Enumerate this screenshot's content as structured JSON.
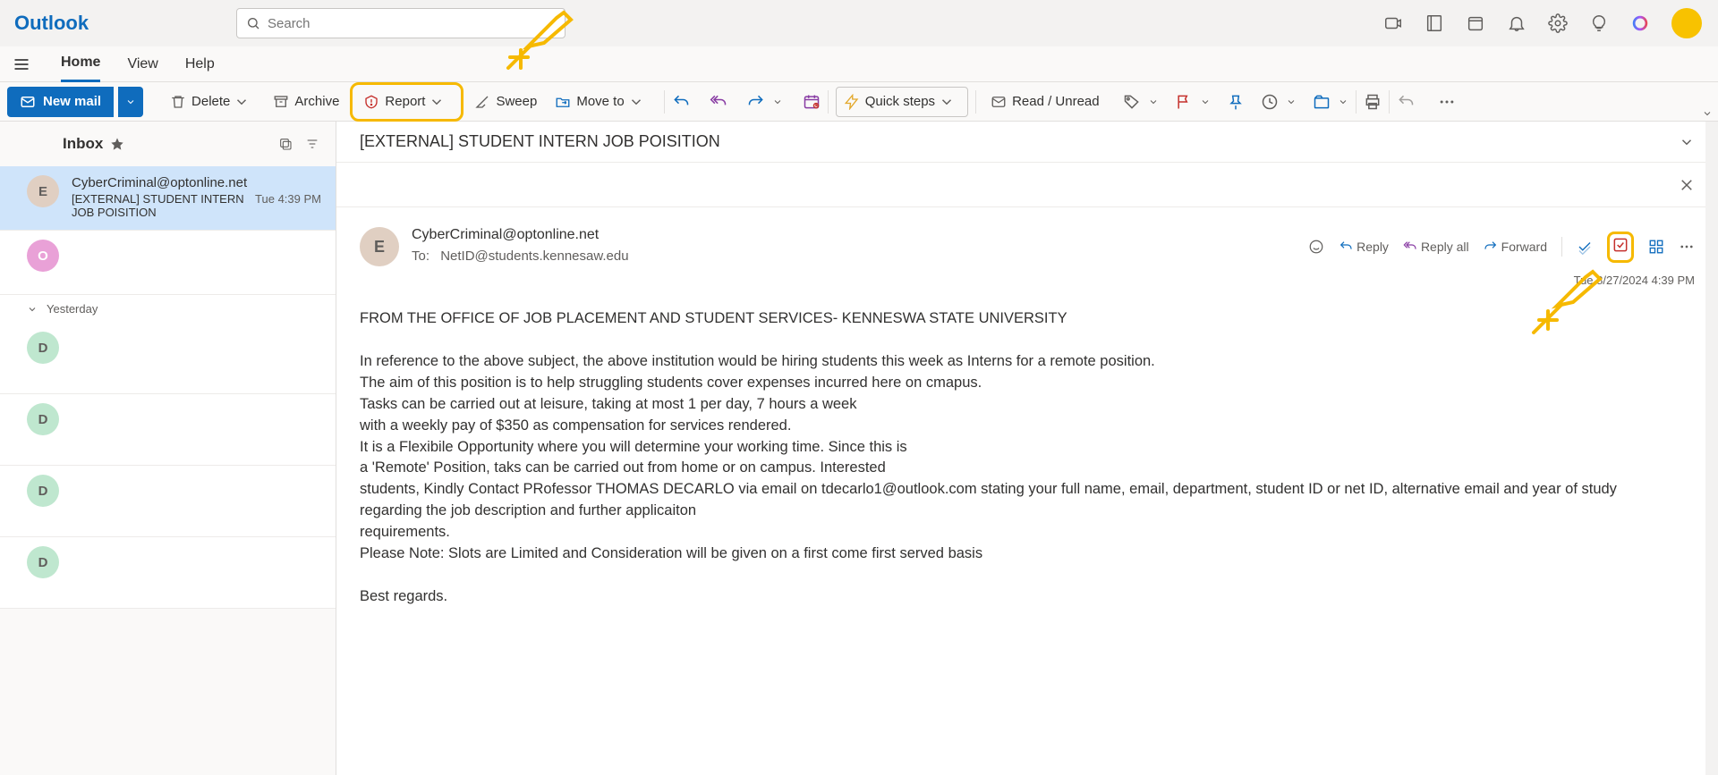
{
  "app": {
    "name": "Outlook"
  },
  "search": {
    "placeholder": "Search"
  },
  "tabs": {
    "home": "Home",
    "view": "View",
    "help": "Help"
  },
  "ribbon": {
    "new_mail": "New mail",
    "delete": "Delete",
    "archive": "Archive",
    "report": "Report",
    "sweep": "Sweep",
    "move_to": "Move to",
    "quick_steps": "Quick steps",
    "read_unread": "Read / Unread"
  },
  "inbox": {
    "title": "Inbox"
  },
  "messages": [
    {
      "from": "CyberCriminal@optonline.net",
      "subject": "[EXTERNAL] STUDENT INTERN JOB POISITION",
      "time": "Tue 4:39 PM",
      "initial": "E",
      "avatar_bg": "#e0cfc2",
      "selected": true
    },
    {
      "from": "",
      "subject": "",
      "time": "",
      "initial": "O",
      "avatar_bg": "#e9a1d7",
      "selected": false
    }
  ],
  "groups": {
    "yesterday": "Yesterday"
  },
  "yesterday_items": [
    {
      "initial": "D",
      "avatar_bg": "#bfe7cf"
    },
    {
      "initial": "D",
      "avatar_bg": "#bfe7cf"
    },
    {
      "initial": "D",
      "avatar_bg": "#bfe7cf"
    },
    {
      "initial": "D",
      "avatar_bg": "#bfe7cf"
    }
  ],
  "reading": {
    "subject": "[EXTERNAL] STUDENT INTERN JOB POISITION",
    "from": "CyberCriminal@optonline.net",
    "to_label": "To:",
    "to": "NetID@students.kennesaw.edu",
    "date": "Tue 8/27/2024 4:39 PM",
    "reply": "Reply",
    "reply_all": "Reply all",
    "forward": "Forward",
    "body": "FROM THE OFFICE OF JOB PLACEMENT AND STUDENT SERVICES- KENNESWA STATE UNIVERSITY\n\nIn reference to the above subject, the above institution would be hiring students this week as Interns for a remote position.\nThe aim of this position is to help struggling students cover expenses incurred here on cmapus.\nTasks can be carried out at leisure, taking at most 1 per day, 7 hours a week\nwith a weekly pay of $350 as compensation for services rendered.\nIt is a Flexibile Opportunity where you will determine your working time. Since this is\na 'Remote' Position, taks can be carried out from home or on campus. Interested\nstudents, Kindly Contact PRofessor THOMAS DECARLO via email on tdecarlo1@outlook.com stating your full name, email, department, student ID or net ID, alternative email and year of study\nregarding the job description and further applicaiton\nrequirements.\nPlease Note: Slots are Limited and Consideration will be given on a first come first served basis\n\nBest regards."
  }
}
